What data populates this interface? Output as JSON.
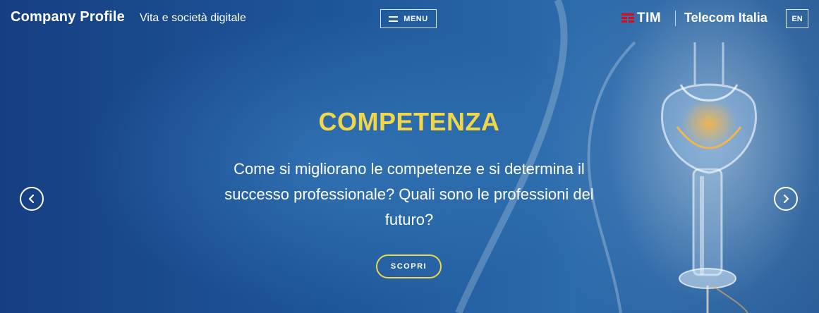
{
  "header": {
    "brand": "Company Profile",
    "tagline": "Vita e società digitale",
    "menu_label": "MENU",
    "tim_label": "TIM",
    "telecom_label": "Telecom Italia",
    "lang_label": "EN"
  },
  "slide": {
    "title": "COMPETENZA",
    "text": "Come si migliorano le competenze e si determina il successo professionale? Quali sono le professioni del futuro?",
    "cta_label": "SCOPRI"
  },
  "icons": {
    "prev": "chevron-left-icon",
    "next": "chevron-right-icon",
    "menu": "hamburger-icon",
    "tim": "tim-logo-icon"
  },
  "colors": {
    "accent_yellow": "#f0d649",
    "brand_red": "#e30613",
    "background_blue": "#1d5698"
  }
}
